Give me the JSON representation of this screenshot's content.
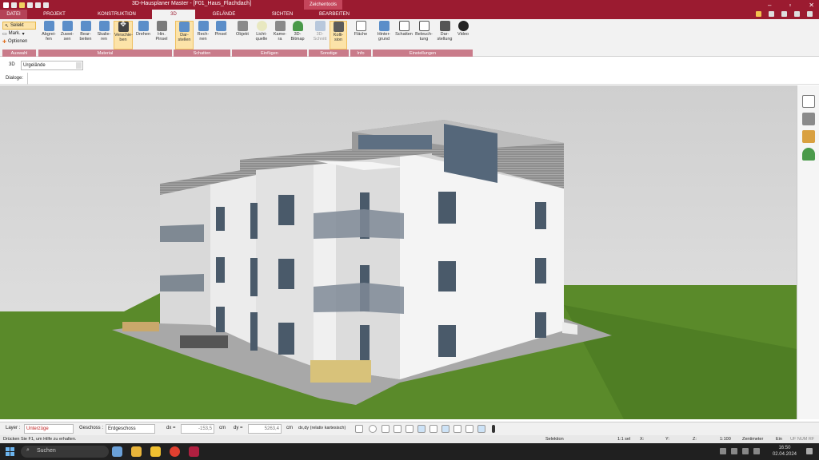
{
  "window": {
    "title": "3D-Hausplaner Master - [F01_Haus_Flachdach]",
    "context_tab": "Zeichentools"
  },
  "tabs": [
    "DATEI",
    "PROJEKT",
    "KONSTRUKTION",
    "3D",
    "GELÄNDE",
    "SICHTEN",
    "BEARBEITEN"
  ],
  "active_tab": "3D",
  "ribbon": {
    "auswahl": {
      "selekt": "Selekt",
      "mark": "Mark.",
      "optionen": "Optionen",
      "label": "Auswahl"
    },
    "material": {
      "label": "Material",
      "buttons": [
        "Abgrei-\nfen",
        "Zuwei-\nsen",
        "Bear-\nbeiten",
        "Skalie-\nren",
        "Verschie-\nben",
        "Drehen",
        "Hin.\nPinsel"
      ]
    },
    "schatten": {
      "label": "Schatten",
      "buttons": [
        "Dar-\nstellen",
        "Rech-\nnen",
        "Pinsel"
      ]
    },
    "einfuegen": {
      "label": "Einfügen",
      "buttons": [
        "Objekt",
        "Licht-\nquelle",
        "Kame-\nra",
        "3D-\nBitmap"
      ]
    },
    "sonstige": {
      "label": "Sonstige",
      "buttons": [
        "3D-\nSchnitt",
        "Kolli-\nsion"
      ]
    },
    "info": {
      "label": "Info",
      "buttons": [
        "Fläche"
      ]
    },
    "einstellungen": {
      "label": "Einstellungen",
      "buttons": [
        "Hinter-\ngrund",
        "Schatten",
        "Beleuch-\ntung",
        "Dar-\nstellung",
        "Video"
      ]
    }
  },
  "propbar": {
    "label": "3D",
    "value": "Urgelände"
  },
  "dialog_label": "Dialoge:",
  "bottom": {
    "layer_label": "Layer :",
    "layer_value": "Unterzüge",
    "geschoss_label": "Geschoss :",
    "geschoss_value": "Erdgeschoss",
    "dx_label": "dx =",
    "dx_value": "-153,5",
    "dx_unit": "cm",
    "dy_label": "dy =",
    "dy_value": "5263,4",
    "dy_unit": "cm",
    "mode": "dx,dy (relativ kartesisch)"
  },
  "status": {
    "help": "Drücken Sie F1, um Hilfe zu erhalten.",
    "mode": "Selektion",
    "sel": "1:1 sel",
    "x": "X:",
    "y": "Y:",
    "z": "Z:",
    "scale": "1:100",
    "unit": "Zentimeter",
    "ein": "Ein",
    "flags": "UF  NUM  RF"
  },
  "taskbar": {
    "search": "Suchen",
    "time": "16:50",
    "date": "02.04.2024"
  },
  "colors": {
    "accent": "#9b1b30",
    "ribbon_group": "#c97b8a",
    "grass": "#5a8a2a",
    "sky": "#d6d6d6"
  }
}
